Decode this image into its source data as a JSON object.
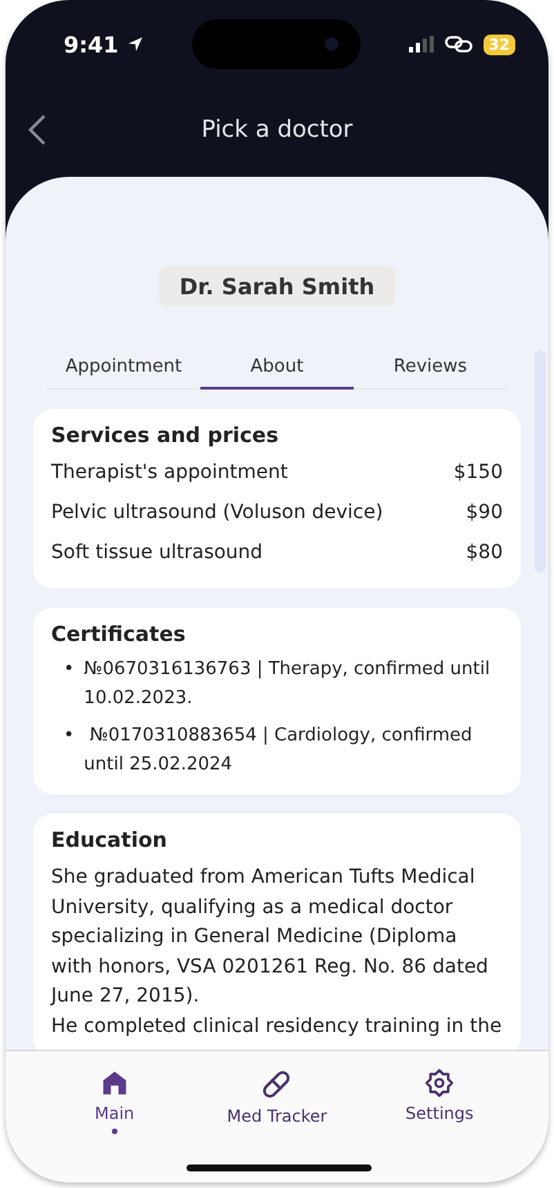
{
  "status_bar": {
    "time": "9:41",
    "battery": "32"
  },
  "header": {
    "title": "Pick a doctor"
  },
  "doctor": {
    "name": "Dr. Sarah Smith"
  },
  "tabs": [
    {
      "label": "Appointment",
      "selected": false
    },
    {
      "label": "About",
      "selected": true
    },
    {
      "label": "Reviews",
      "selected": false
    }
  ],
  "services": {
    "title": "Services and prices",
    "items": [
      {
        "name": "Therapist's appointment",
        "price": "$150"
      },
      {
        "name": "Pelvic ultrasound (Voluson device)",
        "price": "$90"
      },
      {
        "name": "Soft tissue ultrasound",
        "price": "$80"
      }
    ]
  },
  "certificates": {
    "title": "Certificates",
    "items": [
      {
        "bullet": "•",
        "text": "№0670316136763 | Therapy, confirmed until 10.02.2023."
      },
      {
        "bullet": "•",
        "text": " №0170310883654 | Cardiology, confirmed until 25.02.2024"
      }
    ]
  },
  "education": {
    "title": "Education",
    "paragraphs": [
      "She graduated from American Tufts Medical University, qualifying as a medical doctor specializing in General Medicine (Diploma with honors, VSA 0201261 Reg. No. 86 dated June 27, 2015).",
      "He completed clinical residency training in the"
    ]
  },
  "bottom_nav": [
    {
      "kind": "home",
      "label": "Main",
      "selected": true
    },
    {
      "kind": "pill",
      "label": "Med Tracker",
      "selected": false
    },
    {
      "kind": "settings",
      "label": "Settings",
      "selected": false
    }
  ]
}
